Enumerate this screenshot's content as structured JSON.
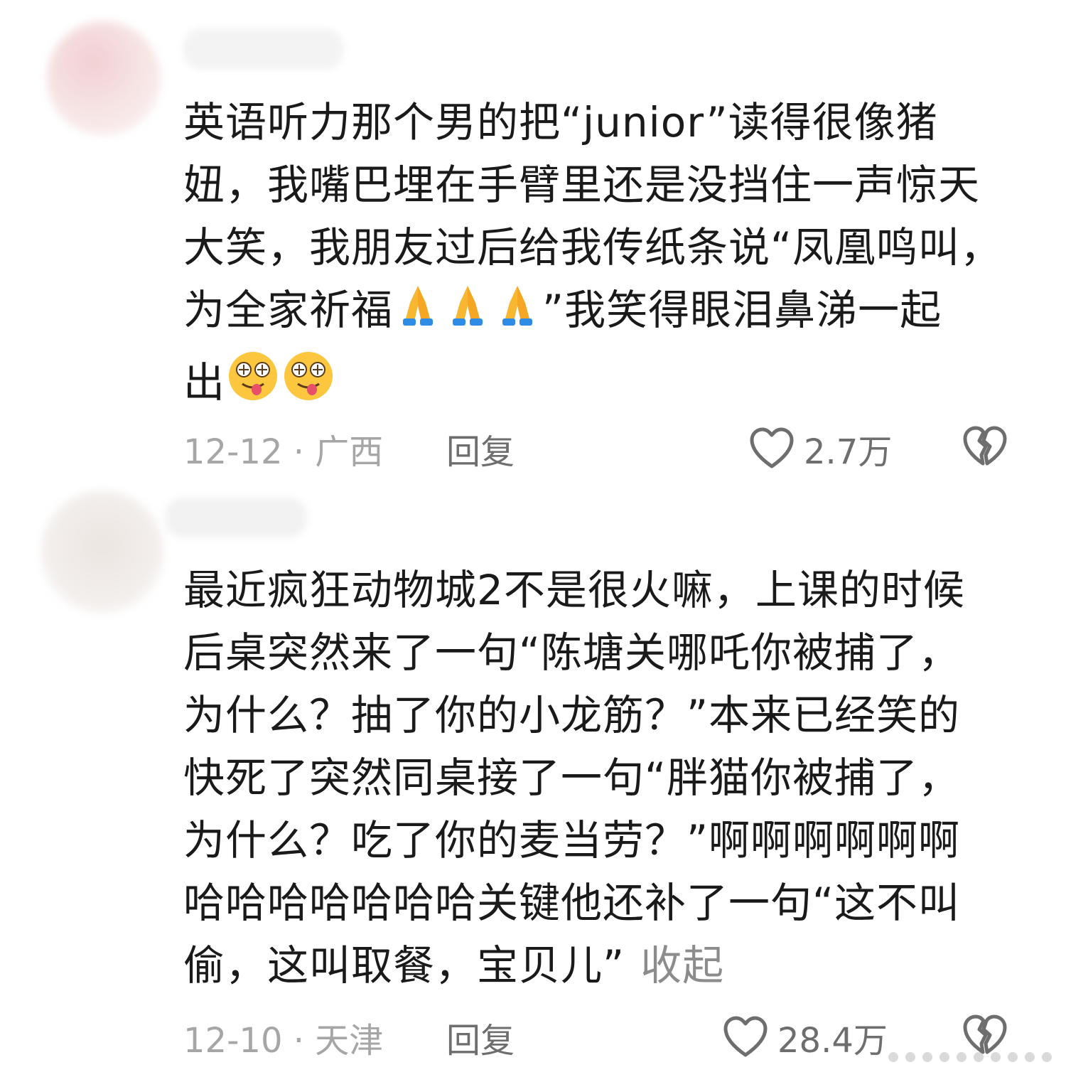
{
  "comments": [
    {
      "lines": [
        "英语听力那个男的把“junior”读得很像猪",
        "妞，我嘴巴埋在手臂里还是没挡住一声惊天",
        "大笑，我朋友过后给我传纸条说“凤凰鸣叫，",
        "为全家祈福",
        "”我笑得眼泪鼻涕一起",
        "出"
      ],
      "date": "12-12",
      "separator": "·",
      "location": "广西",
      "reply_label": "回复",
      "likes": "2.7万",
      "emojis": [
        "folded-hands",
        "folded-hands",
        "folded-hands",
        "drooling-face",
        "drooling-face"
      ]
    },
    {
      "lines": [
        "最近疯狂动物城2不是很火嘛，上课的时候",
        "后桌突然来了一句“陈塘关哪吒你被捕了，",
        "为什么？抽了你的小龙筋？”本来已经笑的",
        "快死了突然同桌接了一句“胖猫你被捕了，",
        "为什么？吃了你的麦当劳？”啊啊啊啊啊啊",
        "哈哈哈哈哈哈哈关键他还补了一句“这不叫",
        "偷，这叫取餐，宝贝儿”"
      ],
      "collapse_label": "收起",
      "date": "12-10",
      "separator": "·",
      "location": "天津",
      "reply_label": "回复",
      "likes": "28.4万"
    }
  ],
  "colors": {
    "text": "#1a1a1a",
    "meta": "#a6a6a6",
    "action": "#6e6e6e",
    "avatar1": "#f6dede",
    "avatar2": "#f0ebe8"
  },
  "icons": [
    "heart-outline-icon",
    "broken-heart-icon"
  ]
}
